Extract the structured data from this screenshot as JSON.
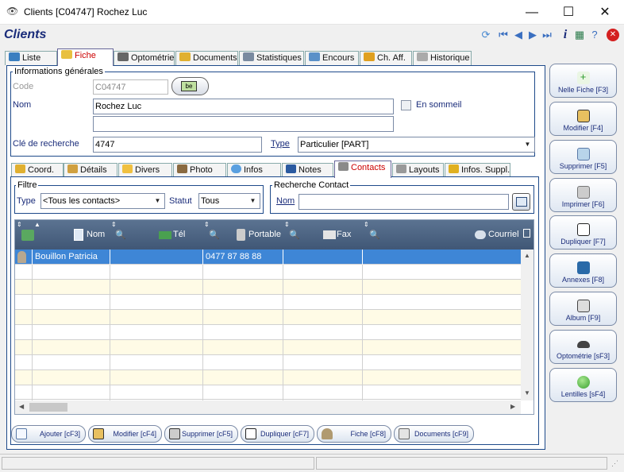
{
  "window": {
    "title": "Clients  [C04747] Rochez Luc",
    "minimize": "—",
    "maximize": "☐",
    "close": "✕"
  },
  "header": {
    "title": "Clients"
  },
  "colors": {
    "accent": "#1a2c7a",
    "selected": "#3e86d6",
    "grid_header": "#4a6282",
    "active_tab": "#cc0000"
  },
  "tabs": [
    {
      "label": "Liste",
      "icon": "list-icon"
    },
    {
      "label": "Fiche",
      "icon": "card-icon"
    },
    {
      "label": "Optométrie",
      "icon": "eye-icon"
    },
    {
      "label": "Documents",
      "icon": "documents-icon"
    },
    {
      "label": "Statistiques",
      "icon": "chart-icon"
    },
    {
      "label": "Encours",
      "icon": "search-icon"
    },
    {
      "label": "Ch. Aff.",
      "icon": "coins-icon"
    },
    {
      "label": "Historique",
      "icon": "history-icon"
    }
  ],
  "general": {
    "legend": "Informations générales",
    "code_label": "Code",
    "code_value": "C04747",
    "nom_label": "Nom",
    "nom_value": "Rochez Luc",
    "nom2_value": "",
    "sommeil_label": "En sommeil",
    "cle_label": "Clé de recherche",
    "cle_value": "4747",
    "type_label": "Type",
    "type_value": "Particulier [PART]"
  },
  "subtabs": [
    {
      "label": "Coord.",
      "icon": "address-icon"
    },
    {
      "label": "Détails",
      "icon": "pencil-icon"
    },
    {
      "label": "Divers",
      "icon": "document-icon"
    },
    {
      "label": "Photo",
      "icon": "photo-icon"
    },
    {
      "label": "Infos",
      "icon": "info-icon"
    },
    {
      "label": "Notes",
      "icon": "book-icon"
    },
    {
      "label": "Contacts",
      "icon": "contact-icon"
    },
    {
      "label": "Layouts",
      "icon": "printer-icon"
    },
    {
      "label": "Infos. Suppl.",
      "icon": "folder-icon"
    }
  ],
  "filter": {
    "legend": "Filtre",
    "type_label": "Type",
    "type_value": "<Tous les contacts>",
    "statut_label": "Statut",
    "statut_value": "Tous"
  },
  "recherche": {
    "legend": "Recherche Contact",
    "nom_label": "Nom",
    "nom_value": ""
  },
  "grid": {
    "columns": [
      "Nom",
      "Tél",
      "Portable",
      "Fax",
      "Courriel"
    ],
    "rows": [
      {
        "nom": "Bouillon Patricia",
        "tel": "",
        "portable": "0477 87 88 88",
        "fax": "",
        "courriel": ""
      }
    ]
  },
  "bottom_buttons": [
    {
      "label": "Ajouter [cF3]",
      "icon": "page-icon"
    },
    {
      "label": "Modifier [cF4]",
      "icon": "edit-icon"
    },
    {
      "label": "Supprimer [cF5]",
      "icon": "trash-icon"
    },
    {
      "label": "Dupliquer [cF7]",
      "icon": "duplicate-icon"
    },
    {
      "label": "Fiche [cF8]",
      "icon": "person-icon"
    },
    {
      "label": "Documents [cF9]",
      "icon": "documents-icon"
    }
  ],
  "right_buttons": [
    {
      "label": "Nelle Fiche [F3]",
      "icon": "new-icon"
    },
    {
      "label": "Modifier [F4]",
      "icon": "edit-icon"
    },
    {
      "label": "Supprimer [F5]",
      "icon": "trash-icon"
    },
    {
      "label": "Imprimer [F6]",
      "icon": "printer-icon"
    },
    {
      "label": "Dupliquer [F7]",
      "icon": "duplicate-icon"
    },
    {
      "label": "Annexes [F8]",
      "icon": "book-icon"
    },
    {
      "label": "Album [F9]",
      "icon": "camera-icon"
    },
    {
      "label": "Optométrie [sF3]",
      "icon": "eye-icon"
    },
    {
      "label": "Lentilles [sF4]",
      "icon": "lens-icon"
    }
  ]
}
